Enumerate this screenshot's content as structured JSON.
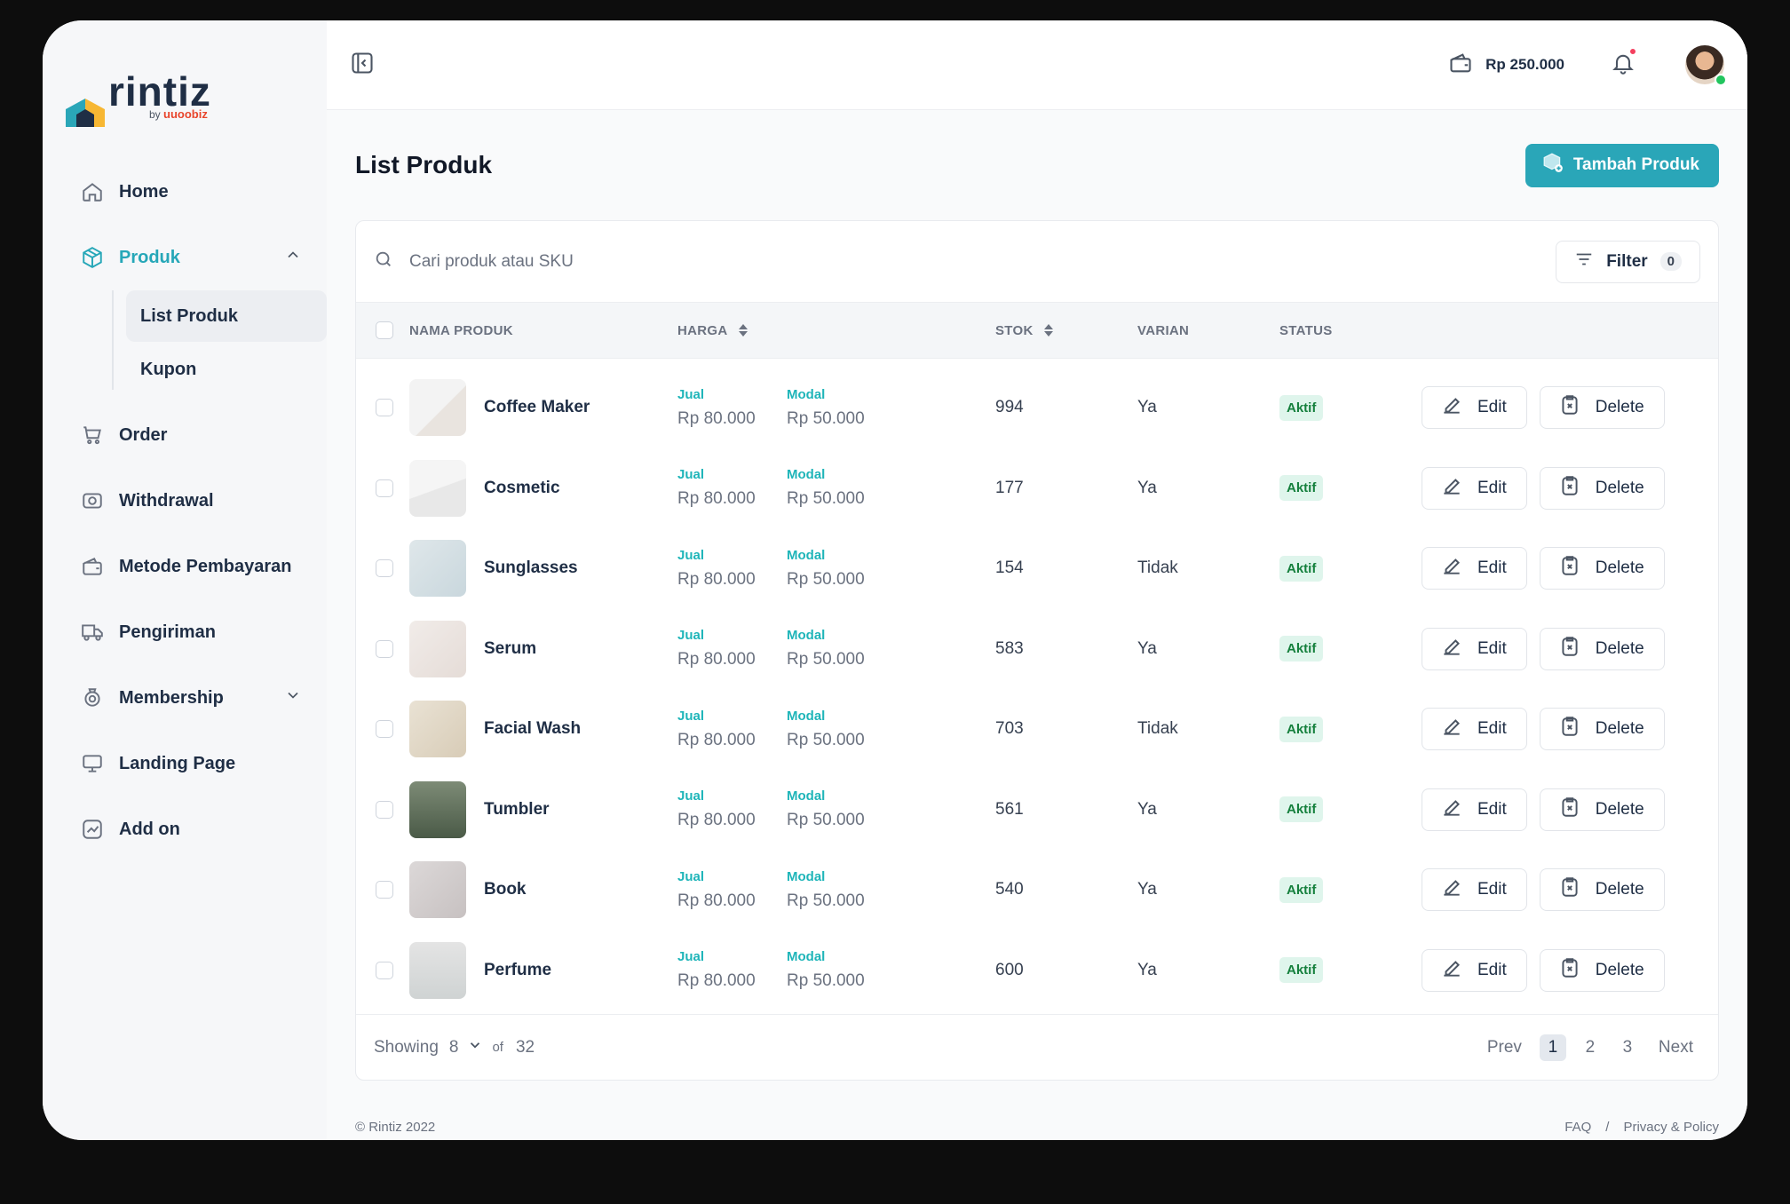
{
  "brand": {
    "name": "rintiz",
    "by_label": "by",
    "by_brand": "uuoobiz"
  },
  "sidebar": {
    "items": [
      {
        "label": "Home"
      },
      {
        "label": "Produk",
        "expanded": true
      },
      {
        "label": "Order"
      },
      {
        "label": "Withdrawal"
      },
      {
        "label": "Metode Pembayaran"
      },
      {
        "label": "Pengiriman"
      },
      {
        "label": "Membership",
        "expanded": false
      },
      {
        "label": "Landing Page"
      },
      {
        "label": "Add on"
      }
    ],
    "produk_sub": [
      {
        "label": "List Produk",
        "active": true
      },
      {
        "label": "Kupon"
      }
    ]
  },
  "topbar": {
    "balance": "Rp 250.000"
  },
  "page": {
    "title": "List Produk",
    "add_button": "Tambah Produk"
  },
  "search": {
    "placeholder": "Cari produk atau SKU"
  },
  "filter": {
    "label": "Filter",
    "count": "0"
  },
  "table": {
    "headers": {
      "name": "NAMA PRODUK",
      "price": "HARGA",
      "stock": "STOK",
      "variant": "VARIAN",
      "status": "STATUS"
    },
    "sell_label": "Jual",
    "cost_label": "Modal",
    "edit_label": "Edit",
    "delete_label": "Delete",
    "rows": [
      {
        "name": "Coffee Maker",
        "jual": "Rp 80.000",
        "modal": "Rp 50.000",
        "stok": "994",
        "varian": "Ya",
        "status": "Aktif"
      },
      {
        "name": "Cosmetic",
        "jual": "Rp 80.000",
        "modal": "Rp 50.000",
        "stok": "177",
        "varian": "Ya",
        "status": "Aktif"
      },
      {
        "name": "Sunglasses",
        "jual": "Rp 80.000",
        "modal": "Rp 50.000",
        "stok": "154",
        "varian": "Tidak",
        "status": "Aktif"
      },
      {
        "name": "Serum",
        "jual": "Rp 80.000",
        "modal": "Rp 50.000",
        "stok": "583",
        "varian": "Ya",
        "status": "Aktif"
      },
      {
        "name": "Facial Wash",
        "jual": "Rp 80.000",
        "modal": "Rp 50.000",
        "stok": "703",
        "varian": "Tidak",
        "status": "Aktif"
      },
      {
        "name": "Tumbler",
        "jual": "Rp 80.000",
        "modal": "Rp 50.000",
        "stok": "561",
        "varian": "Ya",
        "status": "Aktif"
      },
      {
        "name": "Book",
        "jual": "Rp 80.000",
        "modal": "Rp 50.000",
        "stok": "540",
        "varian": "Ya",
        "status": "Aktif"
      },
      {
        "name": "Perfume",
        "jual": "Rp 80.000",
        "modal": "Rp 50.000",
        "stok": "600",
        "varian": "Ya",
        "status": "Aktif"
      }
    ]
  },
  "pagination": {
    "showing_label": "Showing",
    "per_page": "8",
    "of_label": "of",
    "total": "32",
    "prev": "Prev",
    "pages": [
      "1",
      "2",
      "3"
    ],
    "current": "1",
    "next": "Next"
  },
  "footer": {
    "copyright": "© Rintiz 2022",
    "faq": "FAQ",
    "separator": "/",
    "privacy": "Privacy & Policy"
  },
  "colors": {
    "accent": "#2aa6b8",
    "sidebar_bg": "#f6f7f9",
    "status_bg": "#dff5ec",
    "status_text": "#15803d",
    "label_teal": "#1fb5b9"
  }
}
